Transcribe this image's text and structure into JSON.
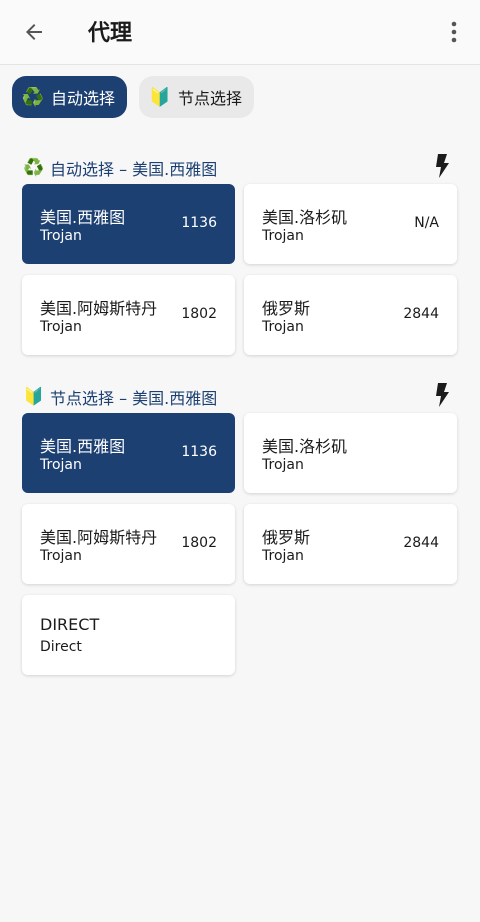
{
  "appbar": {
    "title": "代理"
  },
  "chips": [
    {
      "emoji": "♻️",
      "label": "自动选择",
      "active": true
    },
    {
      "emoji": "🔰",
      "label": "节点选择",
      "active": false
    }
  ],
  "groups": [
    {
      "emoji": "♻️",
      "title": "自动选择 – 美国.西雅图",
      "nodes": [
        {
          "name": "美国.西雅图",
          "type": "Trojan",
          "delay": "1136",
          "selected": true
        },
        {
          "name": "美国.洛杉矶",
          "type": "Trojan",
          "delay": "N/A",
          "selected": false
        },
        {
          "name": "美国.阿姆斯特丹",
          "type": "Trojan",
          "delay": "1802",
          "selected": false
        },
        {
          "name": "俄罗斯",
          "type": "Trojan",
          "delay": "2844",
          "selected": false
        }
      ]
    },
    {
      "emoji": "🔰",
      "title": "节点选择 – 美国.西雅图",
      "nodes": [
        {
          "name": "美国.西雅图",
          "type": "Trojan",
          "delay": "1136",
          "selected": true
        },
        {
          "name": "美国.洛杉矶",
          "type": "Trojan",
          "delay": "",
          "selected": false
        },
        {
          "name": "美国.阿姆斯特丹",
          "type": "Trojan",
          "delay": "1802",
          "selected": false
        },
        {
          "name": "俄罗斯",
          "type": "Trojan",
          "delay": "2844",
          "selected": false
        },
        {
          "name": "DIRECT",
          "type": "Direct",
          "delay": "",
          "selected": false
        }
      ]
    }
  ],
  "colors": {
    "accent": "#1d4073",
    "background": "#f7f7f7",
    "card": "#ffffff"
  },
  "icons": [
    "back-arrow-icon",
    "more-vert-icon",
    "recycle-icon",
    "beginner-icon",
    "lightning-icon"
  ]
}
